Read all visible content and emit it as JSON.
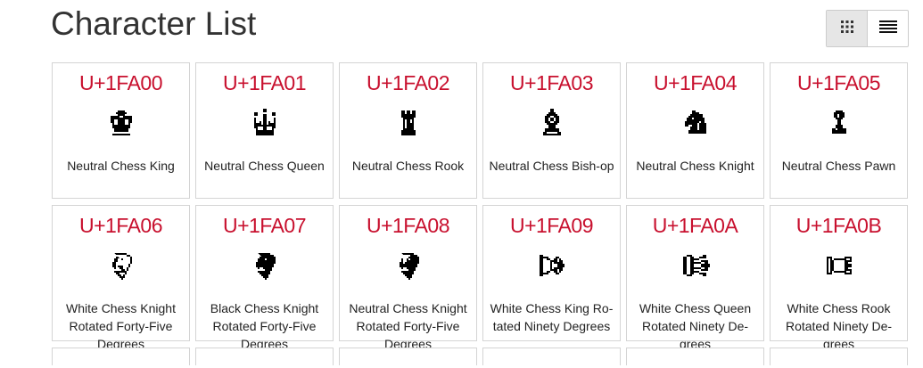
{
  "page": {
    "title": "Character List"
  },
  "view_toggle": {
    "grid_icon": "grid-icon",
    "list_icon": "list-icon",
    "active": "grid"
  },
  "cards": [
    {
      "code": "U+1FA00",
      "name": "Neutral Chess King",
      "icon": "neutral-chess-king-icon"
    },
    {
      "code": "U+1FA01",
      "name": "Neutral Chess Queen",
      "icon": "neutral-chess-queen-icon"
    },
    {
      "code": "U+1FA02",
      "name": "Neutral Chess Rook",
      "icon": "neutral-chess-rook-icon"
    },
    {
      "code": "U+1FA03",
      "name": "Neutral Chess Bish-op",
      "icon": "neutral-chess-bishop-icon"
    },
    {
      "code": "U+1FA04",
      "name": "Neutral Chess Knight",
      "icon": "neutral-chess-knight-icon"
    },
    {
      "code": "U+1FA05",
      "name": "Neutral Chess Pawn",
      "icon": "neutral-chess-pawn-icon"
    },
    {
      "code": "U+1FA06",
      "name": "White Chess Knight Rotated Forty-Five Degrees",
      "icon": "white-knight-rotated-45-icon"
    },
    {
      "code": "U+1FA07",
      "name": "Black Chess Knight Rotated Forty-Five Degrees",
      "icon": "black-knight-rotated-45-icon"
    },
    {
      "code": "U+1FA08",
      "name": "Neutral Chess Knight Rotated Forty-Five Degrees",
      "icon": "neutral-knight-rotated-45-icon"
    },
    {
      "code": "U+1FA09",
      "name": "White Chess King Ro-tated Ninety Degrees",
      "icon": "white-king-rotated-90-icon"
    },
    {
      "code": "U+1FA0A",
      "name": "White Chess Queen Rotated Ninety De-grees",
      "icon": "white-queen-rotated-90-icon"
    },
    {
      "code": "U+1FA0B",
      "name": "White Chess Rook Rotated Ninety De-grees",
      "icon": "white-rook-rotated-90-icon"
    }
  ],
  "colors": {
    "code": "#c8102e",
    "border": "#d4d4d4",
    "title": "#333333"
  }
}
